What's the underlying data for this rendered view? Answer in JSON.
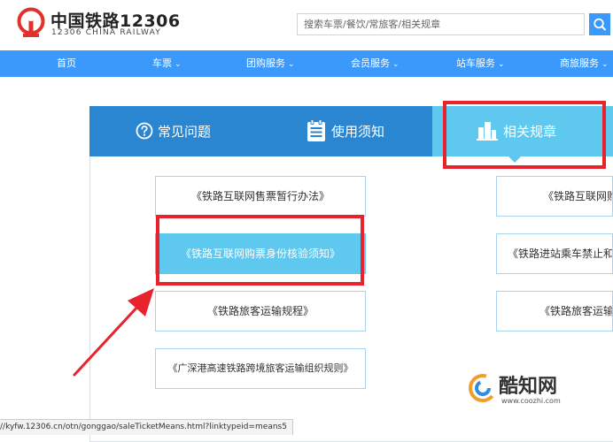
{
  "header": {
    "brand_cn": "中国铁路12306",
    "brand_en": "12306 CHINA RAILWAY",
    "search_placeholder": "搜索车票/餐饮/常旅客/相关规章"
  },
  "nav": {
    "items": [
      {
        "label": "首页",
        "chevron": ""
      },
      {
        "label": "车票",
        "chevron": "⌄"
      },
      {
        "label": "团购服务",
        "chevron": "⌄"
      },
      {
        "label": "会员服务",
        "chevron": "⌄"
      },
      {
        "label": "站车服务",
        "chevron": "⌄"
      },
      {
        "label": "商旅服务",
        "chevron": "⌄"
      }
    ]
  },
  "tabs": [
    {
      "label": "常见问题",
      "icon": "question-circle-icon"
    },
    {
      "label": "使用须知",
      "icon": "notice-list-icon"
    },
    {
      "label": "相关规章",
      "icon": "building-icon",
      "active": true
    }
  ],
  "links": {
    "left": [
      "《铁路互联网售票暂行办法》",
      "《铁路互联网购票身份核验须知》",
      "《铁路旅客运输规程》",
      "《广深港高速铁路跨境旅客运输组织规则》"
    ],
    "right": [
      "《铁路互联网购",
      "《铁路进站乘车禁止和",
      "《铁路旅客运输"
    ],
    "selected_index": 1
  },
  "status_bar": {
    "url": "//kyfw.12306.cn/otn/gonggao/saleTicketMeans.html?linktypeid=means5"
  },
  "watermark": {
    "title": "酷知网",
    "url": "www.coozhi.com"
  },
  "colors": {
    "nav_blue": "#3b99fc",
    "tab_blue": "#2a86d0",
    "active_cyan": "#5ec8ef",
    "annotation_red": "#e8232d",
    "logo_red": "#e0322b"
  }
}
